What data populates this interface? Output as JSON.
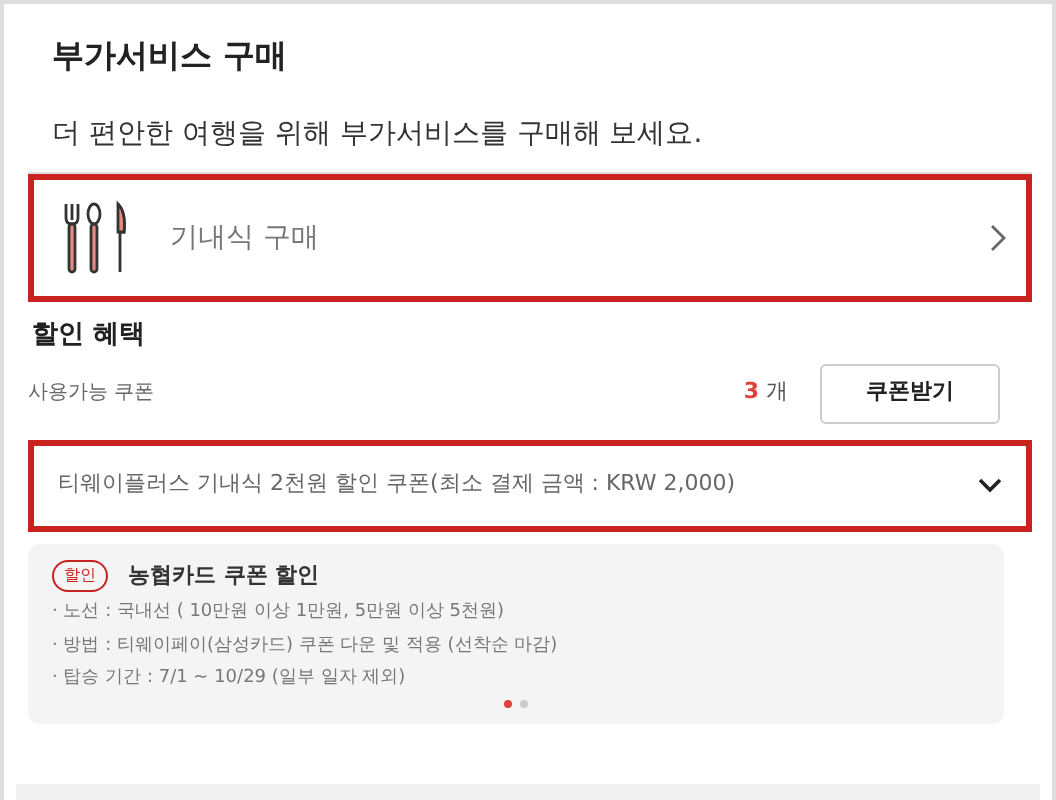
{
  "title": "부가서비스 구매",
  "subtitle": "더 편안한 여행을 위해 부가서비스를 구매해 보세요.",
  "meal_item": {
    "label": "기내식 구매",
    "highlighted": true
  },
  "discount": {
    "heading": "할인 혜택",
    "coupon_label": "사용가능 쿠폰",
    "count": "3",
    "count_unit": "개",
    "button": "쿠폰받기",
    "dropdown": {
      "value": "티웨이플러스 기내식 2천원 할인 쿠폰(최소 결제 금액 : KRW 2,000)",
      "highlighted": true
    }
  },
  "promo": {
    "tag": "할인",
    "title": "농협카드 쿠폰 할인",
    "lines": [
      "· 노선 : 국내선 ( 10만원 이상 1만원, 5만원 이상 5천원)",
      "· 방법 : 티웨이페이(삼성카드) 쿠폰 다운 및 적용 (선착순 마감)",
      "· 탑승 기간 : 7/1 ~ 10/29 (일부 일자 제외)"
    ],
    "pages": [
      {
        "selected": true
      },
      {
        "selected": false
      }
    ]
  }
}
